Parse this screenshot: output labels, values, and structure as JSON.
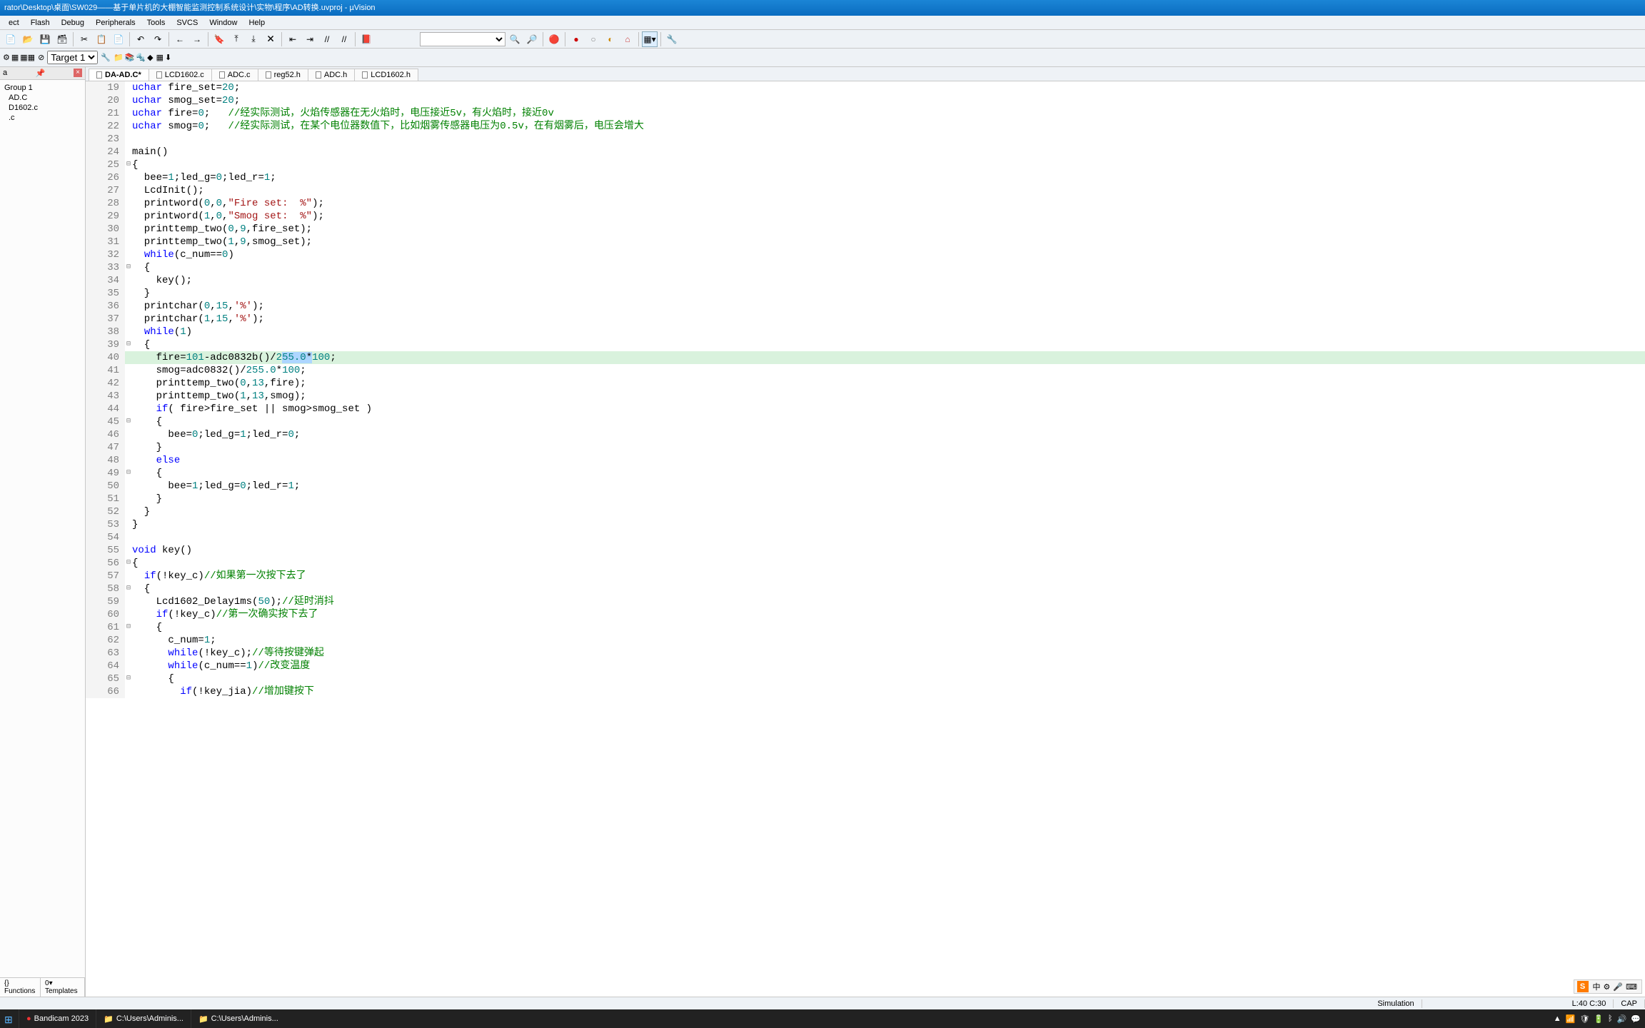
{
  "title": "rator\\Desktop\\桌面\\SW029——基于单片机的大棚智能监测控制系统设计\\实物\\程序\\AD转换.uvproj - µVision",
  "menu": [
    "ect",
    "Flash",
    "Debug",
    "Peripherals",
    "Tools",
    "SVCS",
    "Window",
    "Help"
  ],
  "target_combo": "Target 1",
  "project": {
    "panel_label": "a",
    "root": "Group 1",
    "files": [
      "AD.C",
      "D1602.c",
      ".c"
    ],
    "bottom_tabs": [
      "{} Functions",
      "0▾ Templates"
    ]
  },
  "tabs": [
    {
      "label": "DA-AD.C*",
      "active": true
    },
    {
      "label": "LCD1602.c",
      "active": false
    },
    {
      "label": "ADC.c",
      "active": false
    },
    {
      "label": "reg52.h",
      "active": false
    },
    {
      "label": "ADC.h",
      "active": false
    },
    {
      "label": "LCD1602.h",
      "active": false
    }
  ],
  "code": [
    {
      "n": 19,
      "html": "<span class='kw'>uchar</span> fire_set=<span class='num'>20</span>;"
    },
    {
      "n": 20,
      "html": "<span class='kw'>uchar</span> smog_set=<span class='num'>20</span>;"
    },
    {
      "n": 21,
      "html": "<span class='kw'>uchar</span> fire=<span class='num'>0</span>;   <span class='cmt'>//经实际测试，火焰传感器在无火焰时，电压接近5v，有火焰时，接近0v</span>"
    },
    {
      "n": 22,
      "html": "<span class='kw'>uchar</span> smog=<span class='num'>0</span>;   <span class='cmt'>//经实际测试，在某个电位器数值下，比如烟雾传感器电压为0.5v，在有烟雾后，电压会增大</span>"
    },
    {
      "n": 23,
      "html": ""
    },
    {
      "n": 24,
      "html": "main()"
    },
    {
      "n": 25,
      "fold": "⊟",
      "html": "{"
    },
    {
      "n": 26,
      "html": "  bee=<span class='num'>1</span>;led_g=<span class='num'>0</span>;led_r=<span class='num'>1</span>;"
    },
    {
      "n": 27,
      "html": "  LcdInit();"
    },
    {
      "n": 28,
      "html": "  printword(<span class='num'>0</span>,<span class='num'>0</span>,<span class='str'>\"Fire set:  %\"</span>);"
    },
    {
      "n": 29,
      "html": "  printword(<span class='num'>1</span>,<span class='num'>0</span>,<span class='str'>\"Smog set:  %\"</span>);"
    },
    {
      "n": 30,
      "html": "  printtemp_two(<span class='num'>0</span>,<span class='num'>9</span>,fire_set);"
    },
    {
      "n": 31,
      "html": "  printtemp_two(<span class='num'>1</span>,<span class='num'>9</span>,smog_set);"
    },
    {
      "n": 32,
      "html": "  <span class='kw'>while</span>(c_num==<span class='num'>0</span>)"
    },
    {
      "n": 33,
      "fold": "⊟",
      "html": "  {"
    },
    {
      "n": 34,
      "html": "    key();"
    },
    {
      "n": 35,
      "html": "  }"
    },
    {
      "n": 36,
      "html": "  printchar(<span class='num'>0</span>,<span class='num'>15</span>,<span class='str'>'%'</span>);"
    },
    {
      "n": 37,
      "html": "  printchar(<span class='num'>1</span>,<span class='num'>15</span>,<span class='str'>'%'</span>);"
    },
    {
      "n": 38,
      "html": "  <span class='kw'>while</span>(<span class='num'>1</span>)"
    },
    {
      "n": 39,
      "fold": "⊟",
      "html": "  {"
    },
    {
      "n": 40,
      "hl": true,
      "html": "    fire=<span class='num'>101</span>-adc0832b()/<span class='num'>2</span><span class='sel'><span class='num'>55.0</span>*</span><span class='num'>100</span>;"
    },
    {
      "n": 41,
      "html": "    smog=adc0832()/<span class='num'>255.0</span>*<span class='num'>100</span>;"
    },
    {
      "n": 42,
      "html": "    printtemp_two(<span class='num'>0</span>,<span class='num'>13</span>,fire);"
    },
    {
      "n": 43,
      "html": "    printtemp_two(<span class='num'>1</span>,<span class='num'>13</span>,smog);"
    },
    {
      "n": 44,
      "html": "    <span class='kw'>if</span>( fire>fire_set || smog>smog_set )"
    },
    {
      "n": 45,
      "fold": "⊟",
      "html": "    {"
    },
    {
      "n": 46,
      "html": "      bee=<span class='num'>0</span>;led_g=<span class='num'>1</span>;led_r=<span class='num'>0</span>;"
    },
    {
      "n": 47,
      "html": "    }"
    },
    {
      "n": 48,
      "html": "    <span class='kw'>else</span>"
    },
    {
      "n": 49,
      "fold": "⊟",
      "html": "    {"
    },
    {
      "n": 50,
      "html": "      bee=<span class='num'>1</span>;led_g=<span class='num'>0</span>;led_r=<span class='num'>1</span>;"
    },
    {
      "n": 51,
      "html": "    }"
    },
    {
      "n": 52,
      "html": "  }"
    },
    {
      "n": 53,
      "html": "}"
    },
    {
      "n": 54,
      "html": ""
    },
    {
      "n": 55,
      "html": "<span class='kw'>void</span> key()"
    },
    {
      "n": 56,
      "fold": "⊟",
      "html": "{"
    },
    {
      "n": 57,
      "html": "  <span class='kw'>if</span>(!key_c)<span class='cmt'>//如果第一次按下去了</span>"
    },
    {
      "n": 58,
      "fold": "⊟",
      "html": "  {"
    },
    {
      "n": 59,
      "html": "    Lcd1602_Delay1ms(<span class='num'>50</span>);<span class='cmt'>//延时消抖</span>"
    },
    {
      "n": 60,
      "html": "    <span class='kw'>if</span>(!key_c)<span class='cmt'>//第一次确实按下去了</span>"
    },
    {
      "n": 61,
      "fold": "⊟",
      "html": "    {"
    },
    {
      "n": 62,
      "html": "      c_num=<span class='num'>1</span>;"
    },
    {
      "n": 63,
      "html": "      <span class='kw'>while</span>(!key_c);<span class='cmt'>//等待按键弹起</span>"
    },
    {
      "n": 64,
      "html": "      <span class='kw'>while</span>(c_num==<span class='num'>1</span>)<span class='cmt'>//改变温度</span>"
    },
    {
      "n": 65,
      "fold": "⊟",
      "html": "      {"
    },
    {
      "n": 66,
      "html": "        <span class='kw'>if</span>(!key_jia)<span class='cmt'>//增加键按下</span>"
    }
  ],
  "status": {
    "mode": "Simulation",
    "pos": "L:40 C:30",
    "caps": "CAP"
  },
  "taskbar": {
    "tasks": [
      {
        "icon": "●",
        "iconcolor": "#e33",
        "label": "Bandicam 2023"
      },
      {
        "icon": "📁",
        "iconcolor": "#f5c551",
        "label": "C:\\Users\\Adminis..."
      },
      {
        "icon": "📁",
        "iconcolor": "#f5c551",
        "label": "C:\\Users\\Adminis..."
      }
    ]
  },
  "ime": {
    "logo": "S",
    "items": [
      "中",
      "⚙",
      "🎤",
      "⌨"
    ]
  }
}
